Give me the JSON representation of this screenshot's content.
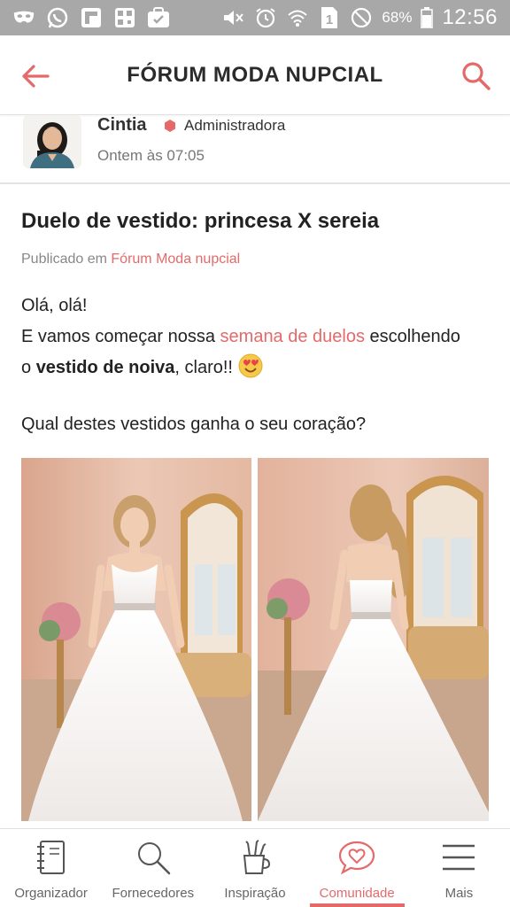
{
  "status_bar": {
    "battery_percent": "68%",
    "time": "12:56",
    "sim_slot": "1",
    "icons_left": [
      "mask-icon",
      "whatsapp-icon",
      "flipboard-icon",
      "qr-icon",
      "briefcase-icon"
    ],
    "icons_right": [
      "mute-icon",
      "alarm-icon",
      "wifi-icon",
      "sim-icon",
      "dnd-icon",
      "battery-icon"
    ]
  },
  "app_bar": {
    "title": "FÓRUM MODA NUPCIAL",
    "back_icon": "arrow-left-icon",
    "search_icon": "search-icon"
  },
  "author": {
    "name": "Cintia",
    "role": "Administradora",
    "time": "Ontem às 07:05"
  },
  "post": {
    "title": "Duelo de vestido: princesa X sereia",
    "meta_prefix": "Publicado em ",
    "meta_link": "Fórum Moda nupcial",
    "line1": "Olá, olá!",
    "line2_a": "E vamos começar nossa ",
    "line2_link": "semana de duelos",
    "line2_b": " escolhendo",
    "line3_a": "o ",
    "line3_bold": "vestido de noiva",
    "line3_b": ", claro!! ",
    "question": "Qual destes vestidos ganha o seu coração?"
  },
  "bottom_nav": {
    "items": [
      {
        "label": "Organizador",
        "icon": "notebook-icon"
      },
      {
        "label": "Fornecedores",
        "icon": "search-icon"
      },
      {
        "label": "Inspiração",
        "icon": "pencil-cup-icon"
      },
      {
        "label": "Comunidade",
        "icon": "chat-heart-icon"
      },
      {
        "label": "Mais",
        "icon": "menu-icon"
      }
    ],
    "active": "Comunidade"
  },
  "colors": {
    "accent": "#e46a6a",
    "status_bar": "#a8a8a8",
    "text": "#222222",
    "muted": "#888888"
  }
}
